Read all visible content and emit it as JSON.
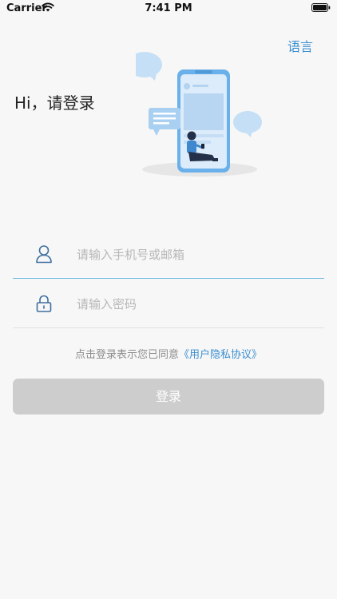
{
  "status_bar": {
    "carrier": "Carrier",
    "time": "7:41 PM"
  },
  "header": {
    "language_label": "语言",
    "greeting": "Hi，请登录"
  },
  "form": {
    "account_placeholder": "请输入手机号或邮箱",
    "password_placeholder": "请输入密码",
    "agreement_text": "点击登录表示您已同意",
    "agreement_link": "《用户隐私协议》",
    "login_label": "登录"
  },
  "colors": {
    "accent": "#3b8fd0",
    "input_active_line": "#6cb6e0",
    "button_disabled": "#cdcdcd",
    "background": "#f7f7f7"
  }
}
